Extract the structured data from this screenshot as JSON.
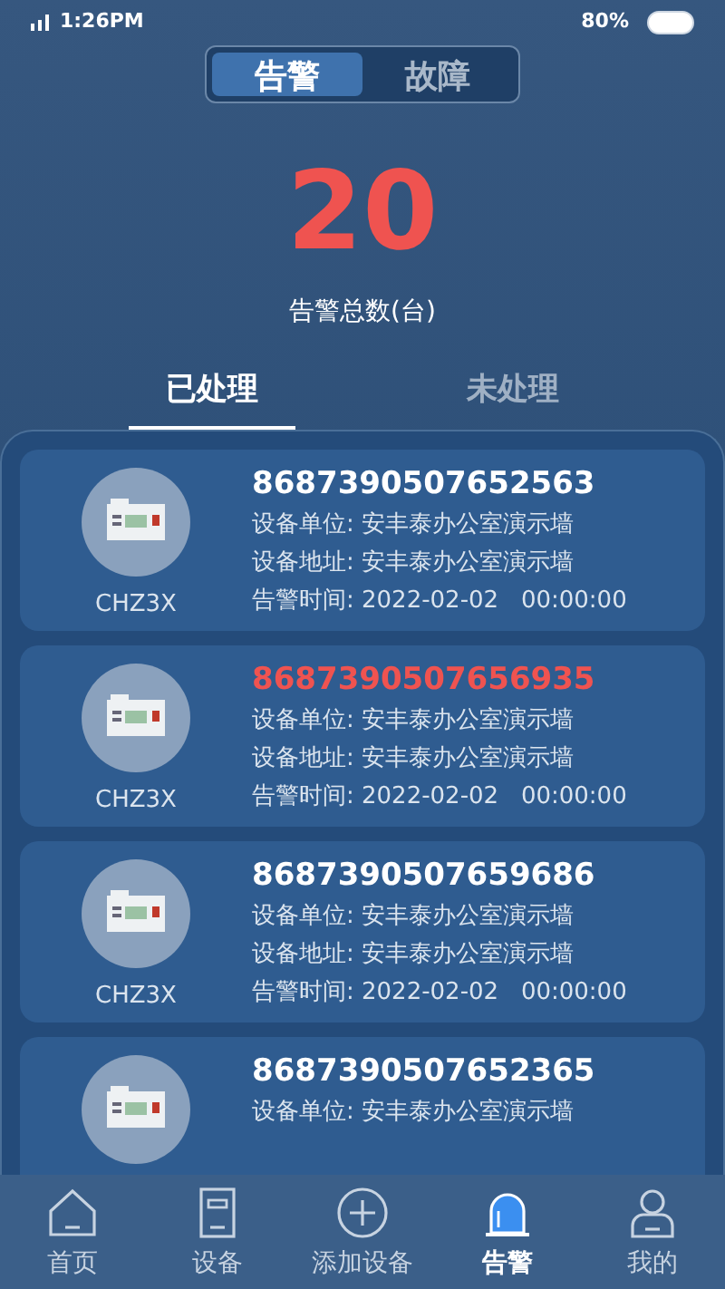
{
  "status_bar": {
    "time": "1:26PM",
    "battery": "80%"
  },
  "segments": [
    {
      "label": "告警",
      "selected": true
    },
    {
      "label": "故障",
      "selected": false
    }
  ],
  "total": {
    "value": "20",
    "label": "告警总数(台)"
  },
  "tabs": [
    {
      "label": "已处理",
      "selected": true
    },
    {
      "label": "未处理",
      "selected": false
    }
  ],
  "devices": [
    {
      "model": "CHZ3X",
      "id": "8687390507652563",
      "highlighted": false,
      "unit": "设备单位: 安丰泰办公室演示墙",
      "address": "设备地址: 安丰泰办公室演示墙",
      "time": "告警时间: 2022-02-02   00:00:00"
    },
    {
      "model": "CHZ3X",
      "id": "8687390507656935",
      "highlighted": true,
      "unit": "设备单位: 安丰泰办公室演示墙",
      "address": "设备地址: 安丰泰办公室演示墙",
      "time": "告警时间: 2022-02-02   00:00:00"
    },
    {
      "model": "CHZ3X",
      "id": "8687390507659686",
      "highlighted": false,
      "unit": "设备单位: 安丰泰办公室演示墙",
      "address": "设备地址: 安丰泰办公室演示墙",
      "time": "告警时间: 2022-02-02   00:00:00"
    },
    {
      "id": "8687390507652365",
      "highlighted": false,
      "unit": "设备单位: 安丰泰办公室演示墙"
    }
  ],
  "nav": [
    {
      "kind": "home",
      "label": "首页",
      "selected": false
    },
    {
      "kind": "device",
      "label": "设备",
      "selected": false
    },
    {
      "kind": "add",
      "label": "添加设备",
      "selected": false
    },
    {
      "kind": "alarm",
      "label": "告警",
      "selected": true
    },
    {
      "kind": "user",
      "label": "我的",
      "selected": false
    }
  ]
}
